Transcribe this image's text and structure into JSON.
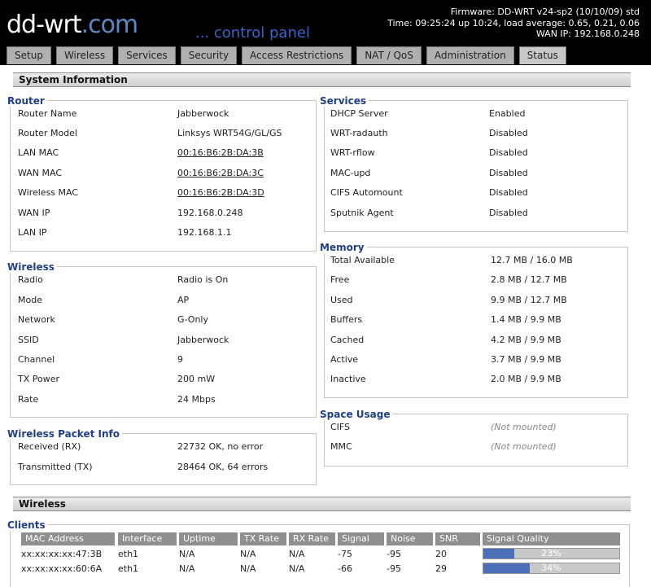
{
  "header": {
    "logo_main": "dd-wrt",
    "logo_dom": ".com",
    "control_panel": "... control panel",
    "firmware": "Firmware: DD-WRT v24-sp2 (10/10/09) std",
    "time": "Time: 09:25:24 up 10:24, load average: 0.65, 0.21, 0.06",
    "wan_ip": "WAN IP: 192.168.0.248"
  },
  "tabs": [
    "Setup",
    "Wireless",
    "Services",
    "Security",
    "Access Restrictions",
    "NAT / QoS",
    "Administration",
    "Status"
  ],
  "system_title": "System Information",
  "router": {
    "legend": "Router",
    "rows": [
      {
        "label": "Router Name",
        "value": "Jabberwock"
      },
      {
        "label": "Router Model",
        "value": "Linksys WRT54G/GL/GS"
      },
      {
        "label": "LAN MAC",
        "value": "00:16:B6:2B:DA:3B"
      },
      {
        "label": "WAN MAC",
        "value": "00:16:B6:2B:DA:3C"
      },
      {
        "label": "Wireless MAC",
        "value": "00:16:B6:2B:DA:3D"
      },
      {
        "label": "WAN IP",
        "value": "192.168.0.248"
      },
      {
        "label": "LAN IP",
        "value": "192.168.1.1"
      }
    ]
  },
  "services": {
    "legend": "Services",
    "rows": [
      {
        "label": "DHCP Server",
        "value": "Enabled"
      },
      {
        "label": "WRT-radauth",
        "value": "Disabled"
      },
      {
        "label": "WRT-rflow",
        "value": "Disabled"
      },
      {
        "label": "MAC-upd",
        "value": "Disabled"
      },
      {
        "label": "CIFS Automount",
        "value": "Disabled"
      },
      {
        "label": "Sputnik Agent",
        "value": "Disabled"
      }
    ]
  },
  "wireless": {
    "legend": "Wireless",
    "rows": [
      {
        "label": "Radio",
        "value": "Radio is On"
      },
      {
        "label": "Mode",
        "value": "AP"
      },
      {
        "label": "Network",
        "value": "G-Only"
      },
      {
        "label": "SSID",
        "value": "Jabberwock"
      },
      {
        "label": "Channel",
        "value": "9"
      },
      {
        "label": "TX Power",
        "value": "200 mW"
      },
      {
        "label": "Rate",
        "value": "24 Mbps"
      }
    ]
  },
  "memory": {
    "legend": "Memory",
    "rows": [
      {
        "label": "Total Available",
        "value": "12.7 MB / 16.0 MB"
      },
      {
        "label": "Free",
        "value": "2.8 MB / 12.7 MB"
      },
      {
        "label": "Used",
        "value": "9.9 MB / 12.7 MB"
      },
      {
        "label": "Buffers",
        "value": "1.4 MB / 9.9 MB"
      },
      {
        "label": "Cached",
        "value": "4.2 MB / 9.9 MB"
      },
      {
        "label": "Active",
        "value": "3.7 MB / 9.9 MB"
      },
      {
        "label": "Inactive",
        "value": "2.0 MB / 9.9 MB"
      }
    ]
  },
  "packet": {
    "legend": "Wireless Packet Info",
    "rows": [
      {
        "label": "Received (RX)",
        "value": "22732 OK, no error"
      },
      {
        "label": "Transmitted (TX)",
        "value": "28464 OK, 64 errors"
      }
    ]
  },
  "space": {
    "legend": "Space Usage",
    "rows": [
      {
        "label": "CIFS",
        "value": "(Not mounted)"
      },
      {
        "label": "MMC",
        "value": "(Not mounted)"
      }
    ]
  },
  "wireless_title": "Wireless",
  "clients": {
    "legend": "Clients",
    "columns": [
      "MAC Address",
      "Interface",
      "Uptime",
      "TX Rate",
      "RX Rate",
      "Signal",
      "Noise",
      "SNR",
      "Signal Quality"
    ],
    "rows": [
      {
        "mac": "xx:xx:xx:xx:47:3B",
        "iface": "eth1",
        "uptime": "N/A",
        "tx": "N/A",
        "rx": "N/A",
        "signal": "-75",
        "noise": "-95",
        "snr": "20",
        "quality_pct": 23,
        "quality": "23%"
      },
      {
        "mac": "xx:xx:xx:xx:60:6A",
        "iface": "eth1",
        "uptime": "N/A",
        "tx": "N/A",
        "rx": "N/A",
        "signal": "-66",
        "noise": "-95",
        "snr": "29",
        "quality_pct": 34,
        "quality": "34%"
      }
    ]
  },
  "colors": {
    "accent": "#4d6fb7",
    "legend": "#1f3f86",
    "header_bg": "#000000"
  }
}
